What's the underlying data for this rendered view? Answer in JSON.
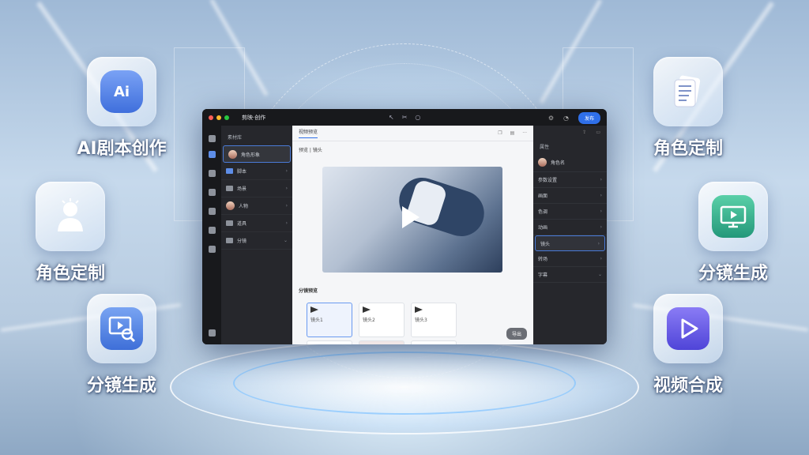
{
  "features_left": [
    {
      "label": "AI剧本创作",
      "icon": "ai-star-icon",
      "badge": "Ai",
      "color": "#4f7fe6"
    },
    {
      "label": "角色定制",
      "icon": "character-bust-icon",
      "color": "#5b8df0"
    },
    {
      "label": "分镜生成",
      "icon": "storyboard-search-icon",
      "color": "#4a7ed9"
    }
  ],
  "features_right": [
    {
      "label": "角色定制",
      "icon": "document-list-icon",
      "color": "#8f6fe0"
    },
    {
      "label": "分镜生成",
      "icon": "monitor-play-icon",
      "color": "#2fa585"
    },
    {
      "label": "视频合成",
      "icon": "play-triangle-icon",
      "color": "#6a5ee8"
    }
  ],
  "app": {
    "title": "剪映·创作",
    "publish_label": "发布",
    "left_panel": {
      "heading": "素材库",
      "items": [
        "角色形象",
        "脚本",
        "场景",
        "人物",
        "道具",
        "分镜"
      ]
    },
    "center": {
      "tab": "视频预览",
      "subtitle": "预览 | 镜头",
      "storyboard_title": "分镜预览",
      "shots": [
        "镜头1",
        "镜头2",
        "镜头3"
      ],
      "export_label": "导出"
    },
    "right_panel": {
      "heading": "属性",
      "character": "角色名",
      "items": [
        "参数设置",
        "画面",
        "色调",
        "动画",
        "镜头",
        "转场",
        "字幕"
      ]
    }
  }
}
